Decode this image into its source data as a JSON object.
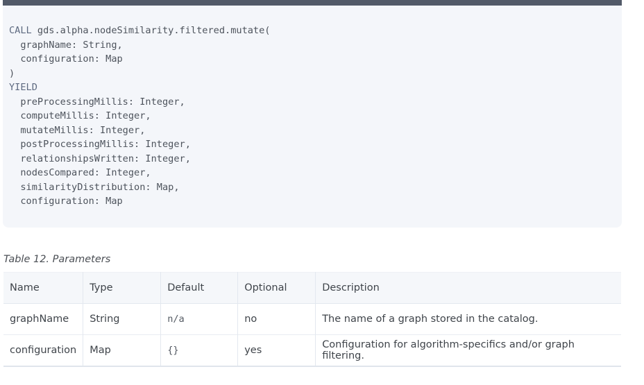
{
  "code": {
    "lines": [
      {
        "kw": "CALL",
        "text": " gds.alpha.nodeSimilarity.filtered.mutate("
      },
      {
        "kw": "",
        "text": "  graphName: String,"
      },
      {
        "kw": "",
        "text": "  configuration: Map"
      },
      {
        "kw": "",
        "text": ")"
      },
      {
        "kw": "YIELD",
        "text": ""
      },
      {
        "kw": "",
        "text": "  preProcessingMillis: Integer,"
      },
      {
        "kw": "",
        "text": "  computeMillis: Integer,"
      },
      {
        "kw": "",
        "text": "  mutateMillis: Integer,"
      },
      {
        "kw": "",
        "text": "  postProcessingMillis: Integer,"
      },
      {
        "kw": "",
        "text": "  relationshipsWritten: Integer,"
      },
      {
        "kw": "",
        "text": "  nodesCompared: Integer,"
      },
      {
        "kw": "",
        "text": "  similarityDistribution: Map,"
      },
      {
        "kw": "",
        "text": "  configuration: Map"
      }
    ]
  },
  "table": {
    "caption": "Table 12. Parameters",
    "headers": [
      "Name",
      "Type",
      "Default",
      "Optional",
      "Description"
    ],
    "rows": [
      [
        "graphName",
        "String",
        "n/a",
        "no",
        "The name of a graph stored in the catalog."
      ],
      [
        "configuration",
        "Map",
        "{}",
        "yes",
        "Configuration for algorithm-specifics and/or graph filtering."
      ]
    ]
  }
}
